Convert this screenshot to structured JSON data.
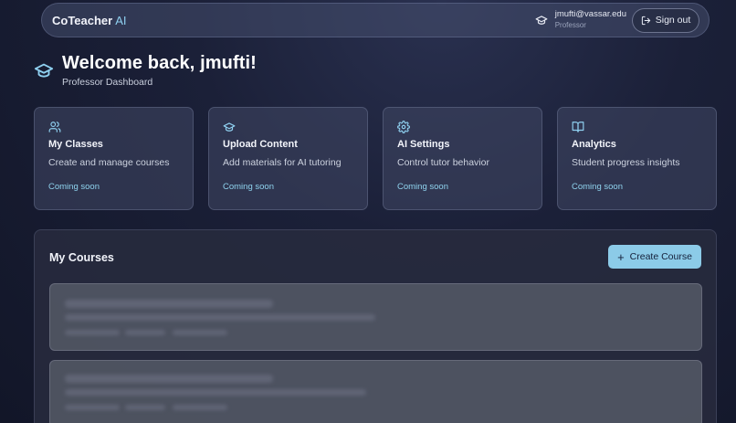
{
  "header": {
    "brand_name": "CoTeacher",
    "brand_suffix": "AI",
    "user_email": "jmufti@vassar.edu",
    "user_role": "Professor",
    "signout_label": "Sign out",
    "icons": [
      "graduation-cap-icon",
      "sign-out-icon"
    ]
  },
  "welcome": {
    "title": "Welcome back, jmufti!",
    "subtitle": "Professor Dashboard",
    "icon": "graduation-cap-icon"
  },
  "cards": [
    {
      "icon": "users-icon",
      "title": "My Classes",
      "description": "Create and manage courses",
      "status": "Coming soon"
    },
    {
      "icon": "graduation-cap-icon",
      "title": "Upload Content",
      "description": "Add materials for AI tutoring",
      "status": "Coming soon"
    },
    {
      "icon": "gear-icon",
      "title": "AI Settings",
      "description": "Control tutor behavior",
      "status": "Coming soon"
    },
    {
      "icon": "book-open-icon",
      "title": "Analytics",
      "description": "Student progress insights",
      "status": "Coming soon"
    }
  ],
  "courses": {
    "heading": "My Courses",
    "create_label": "Create Course",
    "accent_color": "#8ccbe8"
  }
}
